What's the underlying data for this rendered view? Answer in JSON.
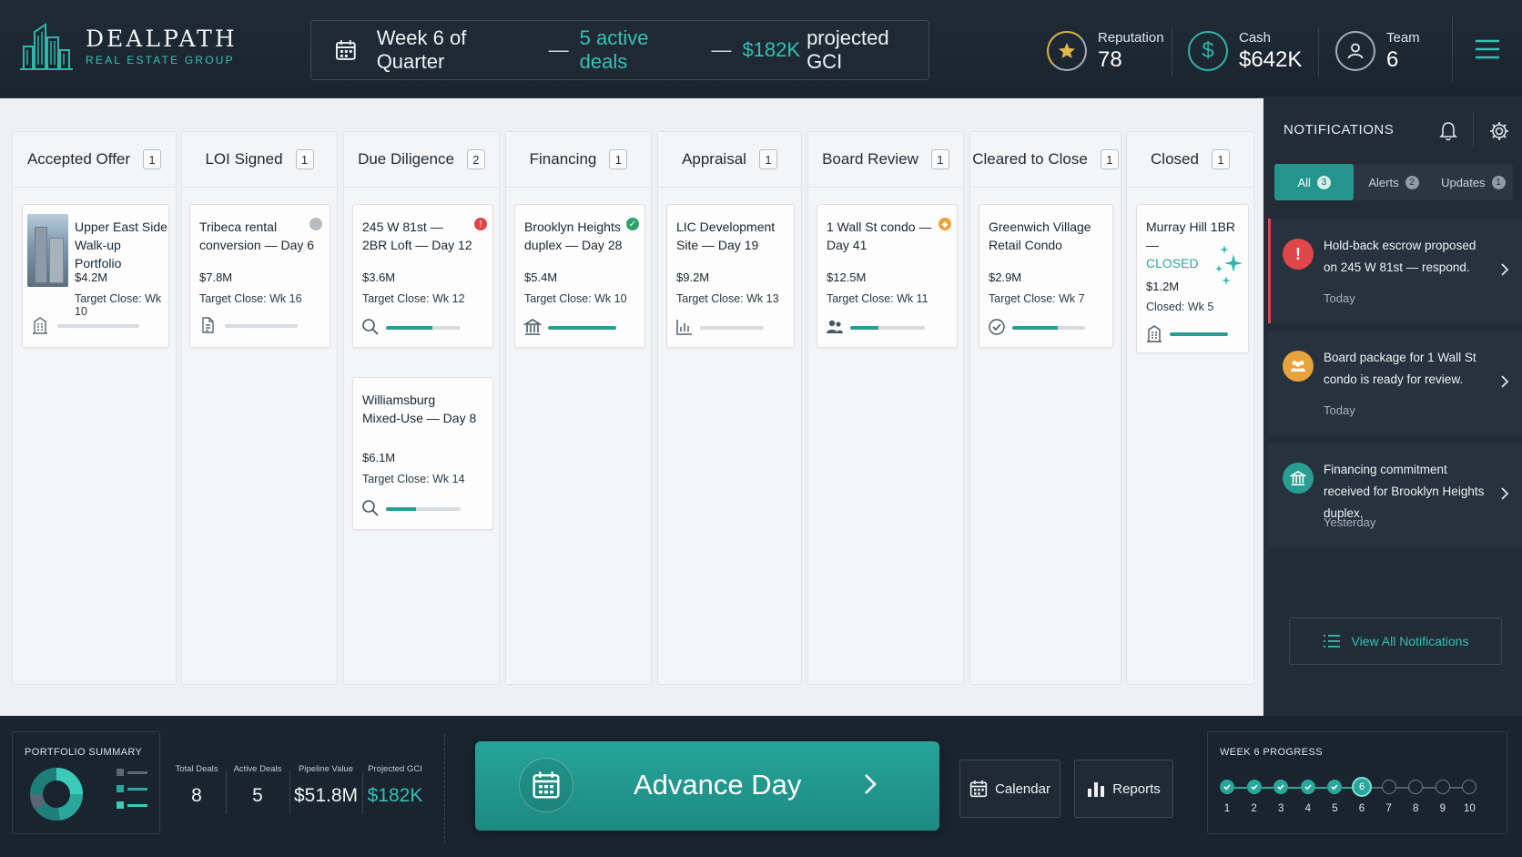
{
  "brand": {
    "name": "DEALPATH",
    "subtitle": "REAL ESTATE GROUP"
  },
  "banner": {
    "week": "Week 6 of Quarter",
    "sep": "—",
    "active_deals": "5 active deals",
    "gci_value": "$182K",
    "gci_label": "projected GCI"
  },
  "stats": {
    "reputation": {
      "label": "Reputation",
      "value": "78"
    },
    "cash": {
      "label": "Cash",
      "value": "$642K"
    },
    "team": {
      "label": "Team",
      "value": "6"
    }
  },
  "columns": [
    {
      "title": "Accepted Offer",
      "count": "1"
    },
    {
      "title": "LOI Signed",
      "count": "1"
    },
    {
      "title": "Due Diligence",
      "count": "2"
    },
    {
      "title": "Financing",
      "count": "1"
    },
    {
      "title": "Appraisal",
      "count": "1"
    },
    {
      "title": "Board Review",
      "count": "1"
    },
    {
      "title": "Cleared to Close",
      "count": "1"
    },
    {
      "title": "Closed",
      "count": "1"
    }
  ],
  "cards": {
    "ues": {
      "title1": "Upper East Side",
      "title2": "Walk-up Portfolio",
      "price": "$4.2M",
      "target": "Target Close: Wk 10",
      "icon": "building-icon",
      "progress": 0.0
    },
    "tribeca": {
      "title1": "Tribeca rental",
      "title2": "conversion — Day 6",
      "price": "$7.8M",
      "target": "Target Close: Wk 16",
      "icon": "document-icon",
      "status": "gray",
      "progress": 0.0
    },
    "w81": {
      "title1": "245 W 81st —",
      "title2": "2BR Loft — Day 12",
      "price": "$3.6M",
      "target": "Target Close: Wk 12",
      "icon": "search-icon",
      "status": "red",
      "progress": 0.62
    },
    "wburg": {
      "title1": "Williamsburg",
      "title2": "Mixed-Use — Day 8",
      "price": "$6.1M",
      "target": "Target Close: Wk 14",
      "icon": "search-icon",
      "progress": 0.4
    },
    "bklyn": {
      "title1": "Brooklyn Heights",
      "title2": "duplex — Day 28",
      "price": "$5.4M",
      "target": "Target Close: Wk 10",
      "icon": "bank-icon",
      "status": "green",
      "progress": 1.0
    },
    "lic": {
      "title1": "LIC Development",
      "title2": "Site — Day 19",
      "price": "$9.2M",
      "target": "Target Close: Wk 13",
      "icon": "chart-icon",
      "progress": 0.0
    },
    "wallst": {
      "title1": "1 Wall St condo —",
      "title2": "Day 41",
      "price": "$12.5M",
      "target": "Target Close: Wk 11",
      "icon": "people-icon",
      "status": "amber",
      "progress": 0.38
    },
    "gv": {
      "title1": "Greenwich Village",
      "title2": "Retail Condo",
      "price": "$2.9M",
      "target": "Target Close: Wk 7",
      "icon": "check-circle-icon",
      "progress": 0.62
    },
    "murray": {
      "title1": "Murray Hill 1BR —",
      "title2": "CLOSED",
      "price": "$1.2M",
      "target": "Closed: Wk 5",
      "icon": "building-icon",
      "progress": 1.0
    }
  },
  "notifications": {
    "title": "NOTIFICATIONS",
    "tabs": [
      {
        "label": "All",
        "count": "3"
      },
      {
        "label": "Alerts",
        "count": "2"
      },
      {
        "label": "Updates",
        "count": "1"
      }
    ],
    "items": [
      {
        "text": "Hold-back escrow proposed on 245 W 81st — respond.",
        "time": "Today",
        "color": "#e0454a",
        "icon": "alert-icon"
      },
      {
        "text": "Board package for 1 Wall St condo is ready for review.",
        "time": "Today",
        "color": "#e9a33b",
        "icon": "people-icon"
      },
      {
        "text": "Financing commitment received for Brooklyn Heights duplex.",
        "time": "Yesterday",
        "color": "#2a9d93",
        "icon": "bank-icon"
      }
    ],
    "view_all": "View All Notifications"
  },
  "footer": {
    "portfolio_title": "PORTFOLIO SUMMARY",
    "metrics": [
      {
        "label": "Total Deals",
        "value": "8"
      },
      {
        "label": "Active Deals",
        "value": "5"
      },
      {
        "label": "Pipeline Value",
        "value": "$51.8M"
      },
      {
        "label": "Projected GCI",
        "value": "$182K"
      }
    ],
    "advance_label": "Advance Day",
    "calendar_label": "Calendar",
    "reports_label": "Reports",
    "progress_title": "WEEK 6 PROGRESS",
    "weeks": [
      "1",
      "2",
      "3",
      "4",
      "5",
      "6",
      "7",
      "8",
      "9",
      "10"
    ],
    "current_week": 6
  },
  "colors": {
    "accent": "#2aa79b",
    "alert": "#e0454a",
    "warning": "#e9a33b",
    "bg": "#1b2530"
  }
}
